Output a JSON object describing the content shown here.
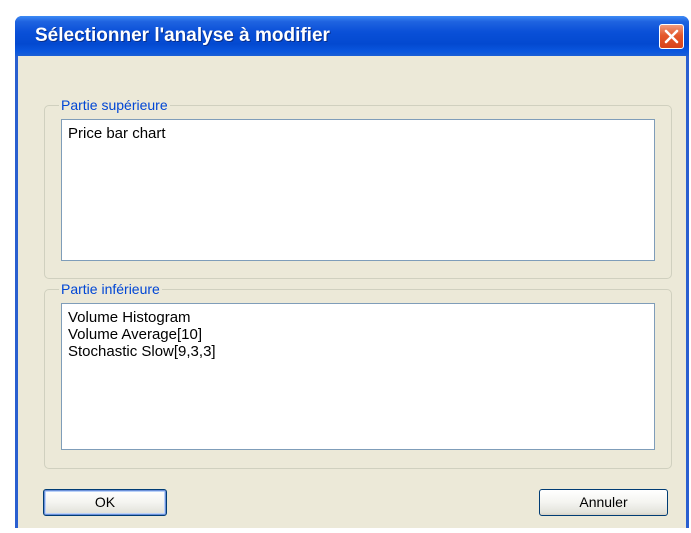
{
  "window": {
    "title": "Sélectionner l'analyse à modifier"
  },
  "upper": {
    "legend": "Partie supérieure",
    "items": [
      "Price bar chart"
    ]
  },
  "lower": {
    "legend": "Partie inférieure",
    "items": [
      "Volume Histogram",
      "Volume Average[10]",
      "Stochastic Slow[9,3,3]"
    ]
  },
  "buttons": {
    "ok_label": "OK",
    "cancel_label": "Annuler"
  },
  "colors": {
    "titlebar": "#0349d0",
    "dialog_bg": "#ece9d8",
    "legend_text": "#0046d5",
    "close_button": "#e4582b"
  }
}
